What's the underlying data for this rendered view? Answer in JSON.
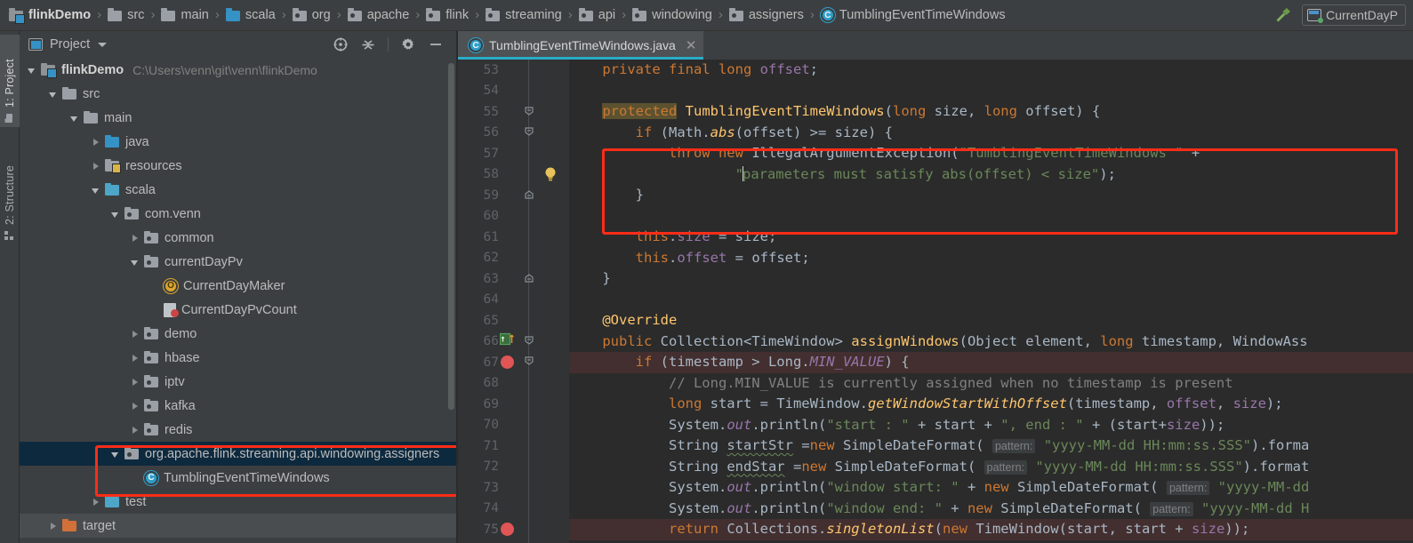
{
  "window": {
    "theme_bg": "#3c3f41",
    "editor_bg": "#2b2b2b",
    "accent": "#2aacc8",
    "annotation_color": "#fc2d18"
  },
  "navbar": {
    "crumbs": [
      {
        "label": "flinkDemo",
        "icon": "project-folder-icon",
        "kind": "project"
      },
      {
        "label": "src",
        "icon": "folder-icon",
        "kind": "folder-gray"
      },
      {
        "label": "main",
        "icon": "folder-icon",
        "kind": "folder-gray"
      },
      {
        "label": "scala",
        "icon": "folder-icon",
        "kind": "folder-blue"
      },
      {
        "label": "org",
        "icon": "package-icon",
        "kind": "package"
      },
      {
        "label": "apache",
        "icon": "package-icon",
        "kind": "package"
      },
      {
        "label": "flink",
        "icon": "package-icon",
        "kind": "package"
      },
      {
        "label": "streaming",
        "icon": "package-icon",
        "kind": "package"
      },
      {
        "label": "api",
        "icon": "package-icon",
        "kind": "package"
      },
      {
        "label": "windowing",
        "icon": "package-icon",
        "kind": "package"
      },
      {
        "label": "assigners",
        "icon": "package-icon",
        "kind": "package"
      },
      {
        "label": "TumblingEventTimeWindows",
        "icon": "java-class-icon",
        "kind": "class"
      }
    ],
    "separator": "›",
    "build_icon": "hammer-icon",
    "run_config": {
      "label": "CurrentDayP",
      "icon": "run-configuration-icon"
    }
  },
  "tool_tabs": [
    {
      "label": "1: Project",
      "icon": "project-icon",
      "active": true
    },
    {
      "label": "2: Structure",
      "icon": "structure-icon",
      "active": false
    }
  ],
  "project_panel": {
    "title": "Project",
    "title_icon": "project-view-icon",
    "dropdown_icon": "chevron-down-icon",
    "actions": [
      {
        "name": "select-opened-file-icon",
        "label": "Select Opened File"
      },
      {
        "name": "collapse-all-icon",
        "label": "Collapse All"
      },
      {
        "name": "gear-icon",
        "label": "Settings"
      },
      {
        "name": "minimize-icon",
        "label": "Hide"
      }
    ],
    "tree": [
      {
        "label": "flinkDemo",
        "path": "C:\\Users\\venn\\git\\venn\\flinkDemo",
        "indent": 0,
        "state": "expanded",
        "icon": "project-folder-icon",
        "bold": true
      },
      {
        "label": "src",
        "path": "",
        "indent": 1,
        "state": "expanded",
        "icon": "folder-gray-icon",
        "bold": false
      },
      {
        "label": "main",
        "path": "",
        "indent": 2,
        "state": "expanded",
        "icon": "folder-gray-icon",
        "bold": false
      },
      {
        "label": "java",
        "path": "",
        "indent": 3,
        "state": "collapsed",
        "icon": "folder-blue-icon",
        "bold": false
      },
      {
        "label": "resources",
        "path": "",
        "indent": 3,
        "state": "collapsed",
        "icon": "resources-folder-icon",
        "bold": false
      },
      {
        "label": "scala",
        "path": "",
        "indent": 3,
        "state": "expanded",
        "icon": "folder-teal-icon",
        "bold": false
      },
      {
        "label": "com.venn",
        "path": "",
        "indent": 4,
        "state": "expanded",
        "icon": "package-icon",
        "bold": false
      },
      {
        "label": "common",
        "path": "",
        "indent": 5,
        "state": "collapsed",
        "icon": "package-icon",
        "bold": false
      },
      {
        "label": "currentDayPv",
        "path": "",
        "indent": 5,
        "state": "expanded",
        "icon": "package-icon",
        "bold": false
      },
      {
        "label": "CurrentDayMaker",
        "path": "",
        "indent": 6,
        "state": "leaf",
        "icon": "scala-object-icon",
        "bold": false
      },
      {
        "label": "CurrentDayPvCount",
        "path": "",
        "indent": 6,
        "state": "leaf",
        "icon": "scala-class-icon",
        "bold": false
      },
      {
        "label": "demo",
        "path": "",
        "indent": 5,
        "state": "collapsed",
        "icon": "package-icon",
        "bold": false
      },
      {
        "label": "hbase",
        "path": "",
        "indent": 5,
        "state": "collapsed",
        "icon": "package-icon",
        "bold": false
      },
      {
        "label": "iptv",
        "path": "",
        "indent": 5,
        "state": "collapsed",
        "icon": "package-icon",
        "bold": false
      },
      {
        "label": "kafka",
        "path": "",
        "indent": 5,
        "state": "collapsed",
        "icon": "package-icon",
        "bold": false
      },
      {
        "label": "redis",
        "path": "",
        "indent": 5,
        "state": "collapsed",
        "icon": "package-icon",
        "bold": false
      },
      {
        "label": "org.apache.flink.streaming.api.windowing.assigners",
        "path": "",
        "indent": 4,
        "state": "expanded",
        "icon": "package-icon",
        "bold": false,
        "selected": true
      },
      {
        "label": "TumblingEventTimeWindows",
        "path": "",
        "indent": 5,
        "state": "leaf",
        "icon": "java-class-icon",
        "bold": false
      },
      {
        "label": "test",
        "path": "",
        "indent": 3,
        "state": "collapsed",
        "icon": "folder-teal-icon",
        "bold": false
      },
      {
        "label": "target",
        "path": "",
        "indent": 1,
        "state": "collapsed",
        "icon": "folder-orange-icon",
        "bold": false
      }
    ]
  },
  "editor": {
    "tab": {
      "label": "TumblingEventTimeWindows.java",
      "icon": "java-class-icon",
      "close_icon": "close-icon",
      "active": true
    },
    "first_line_number": 53,
    "last_line_number": 75,
    "gutter_markers": [
      {
        "line": 58,
        "type": "intention-bulb-icon"
      },
      {
        "line": 66,
        "type": "overriding-method-icon"
      },
      {
        "line": 67,
        "type": "breakpoint-icon"
      },
      {
        "line": 75,
        "type": "breakpoint-icon"
      }
    ],
    "lines": [
      {
        "n": 53,
        "text": "    private final long offset;"
      },
      {
        "n": 54,
        "text": ""
      },
      {
        "n": 55,
        "text": "    protected TumblingEventTimeWindows(long size, long offset) {"
      },
      {
        "n": 56,
        "text": "        if (Math.abs(offset) >= size) {"
      },
      {
        "n": 57,
        "text": "            throw new IllegalArgumentException(\"TumblingEventTimeWindows \" +"
      },
      {
        "n": 58,
        "text": "                    \"parameters must satisfy abs(offset) < size\");"
      },
      {
        "n": 59,
        "text": "        }"
      },
      {
        "n": 60,
        "text": ""
      },
      {
        "n": 61,
        "text": "        this.size = size;"
      },
      {
        "n": 62,
        "text": "        this.offset = offset;"
      },
      {
        "n": 63,
        "text": "    }"
      },
      {
        "n": 64,
        "text": ""
      },
      {
        "n": 65,
        "text": "    @Override"
      },
      {
        "n": 66,
        "text": "    public Collection<TimeWindow> assignWindows(Object element, long timestamp, WindowAss"
      },
      {
        "n": 67,
        "text": "        if (timestamp > Long.MIN_VALUE) {"
      },
      {
        "n": 68,
        "text": "            // Long.MIN_VALUE is currently assigned when no timestamp is present"
      },
      {
        "n": 69,
        "text": "            long start = TimeWindow.getWindowStartWithOffset(timestamp, offset, size);"
      },
      {
        "n": 70,
        "text": "            System.out.println(\"start : \" + start + \", end : \" + (start+size));"
      },
      {
        "n": 71,
        "text": "            String startStr =new SimpleDateFormat( pattern: \"yyyy-MM-dd HH:mm:ss.SSS\").forma"
      },
      {
        "n": 72,
        "text": "            String endStar =new SimpleDateFormat( pattern: \"yyyy-MM-dd HH:mm:ss.SSS\").format"
      },
      {
        "n": 73,
        "text": "            System.out.println(\"window start: \" + new SimpleDateFormat( pattern: \"yyyy-MM-dd"
      },
      {
        "n": 74,
        "text": "            System.out.println(\"window end: \" + new SimpleDateFormat( pattern: \"yyyy-MM-dd H"
      },
      {
        "n": 75,
        "text": "            return Collections.singletonList(new TimeWindow(start, start + size));"
      }
    ],
    "parameter_hint_label": "pattern:"
  },
  "annotations": [
    {
      "name": "code-block-highlight",
      "target": "lines 56-59 throw IllegalArgumentException block"
    },
    {
      "name": "tree-package-highlight",
      "target": "org.apache.flink.streaming.api.windowing.assigners package and TumblingEventTimeWindows class"
    }
  ]
}
